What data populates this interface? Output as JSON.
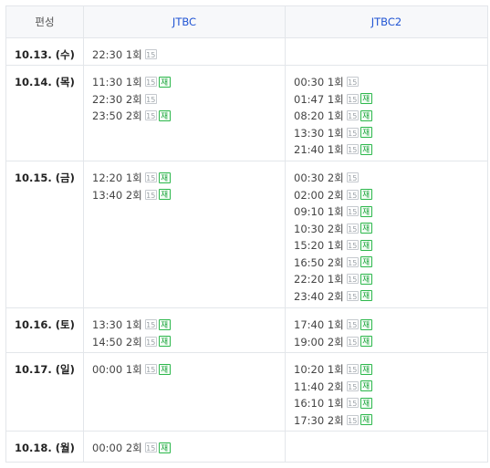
{
  "header": {
    "label": "편성",
    "ch1": "JTBC",
    "ch2": "JTBC2"
  },
  "rating_label": "15",
  "rerun_label": "재",
  "colors": {
    "channel_header": "#2155d4",
    "rerun_badge": "#1aa33a",
    "border": "#e3e6ea"
  },
  "rows": [
    {
      "date": "10.13. (수)",
      "jtbc": [
        {
          "time": "22:30",
          "ep": "1회",
          "rerun": false
        }
      ],
      "jtbc2": []
    },
    {
      "date": "10.14. (목)",
      "jtbc": [
        {
          "time": "11:30",
          "ep": "1회",
          "rerun": true
        },
        {
          "time": "22:30",
          "ep": "2회",
          "rerun": false
        },
        {
          "time": "23:50",
          "ep": "2회",
          "rerun": true
        }
      ],
      "jtbc2": [
        {
          "time": "00:30",
          "ep": "1회",
          "rerun": false
        },
        {
          "time": "01:47",
          "ep": "1회",
          "rerun": true
        },
        {
          "time": "08:20",
          "ep": "1회",
          "rerun": true
        },
        {
          "time": "13:30",
          "ep": "1회",
          "rerun": true
        },
        {
          "time": "21:40",
          "ep": "1회",
          "rerun": true
        }
      ]
    },
    {
      "date": "10.15. (금)",
      "jtbc": [
        {
          "time": "12:20",
          "ep": "1회",
          "rerun": true
        },
        {
          "time": "13:40",
          "ep": "2회",
          "rerun": true
        }
      ],
      "jtbc2": [
        {
          "time": "00:30",
          "ep": "2회",
          "rerun": false
        },
        {
          "time": "02:00",
          "ep": "2회",
          "rerun": true
        },
        {
          "time": "09:10",
          "ep": "1회",
          "rerun": true
        },
        {
          "time": "10:30",
          "ep": "2회",
          "rerun": true
        },
        {
          "time": "15:20",
          "ep": "1회",
          "rerun": true
        },
        {
          "time": "16:50",
          "ep": "2회",
          "rerun": true
        },
        {
          "time": "22:20",
          "ep": "1회",
          "rerun": true
        },
        {
          "time": "23:40",
          "ep": "2회",
          "rerun": true
        }
      ]
    },
    {
      "date": "10.16. (토)",
      "jtbc": [
        {
          "time": "13:30",
          "ep": "1회",
          "rerun": true
        },
        {
          "time": "14:50",
          "ep": "2회",
          "rerun": true
        }
      ],
      "jtbc2": [
        {
          "time": "17:40",
          "ep": "1회",
          "rerun": true
        },
        {
          "time": "19:00",
          "ep": "2회",
          "rerun": true
        }
      ]
    },
    {
      "date": "10.17. (일)",
      "jtbc": [
        {
          "time": "00:00",
          "ep": "1회",
          "rerun": true
        }
      ],
      "jtbc2": [
        {
          "time": "10:20",
          "ep": "1회",
          "rerun": true
        },
        {
          "time": "11:40",
          "ep": "2회",
          "rerun": true
        },
        {
          "time": "16:10",
          "ep": "1회",
          "rerun": true
        },
        {
          "time": "17:30",
          "ep": "2회",
          "rerun": true
        }
      ]
    },
    {
      "date": "10.18. (월)",
      "jtbc": [
        {
          "time": "00:00",
          "ep": "2회",
          "rerun": true
        }
      ],
      "jtbc2": []
    }
  ]
}
